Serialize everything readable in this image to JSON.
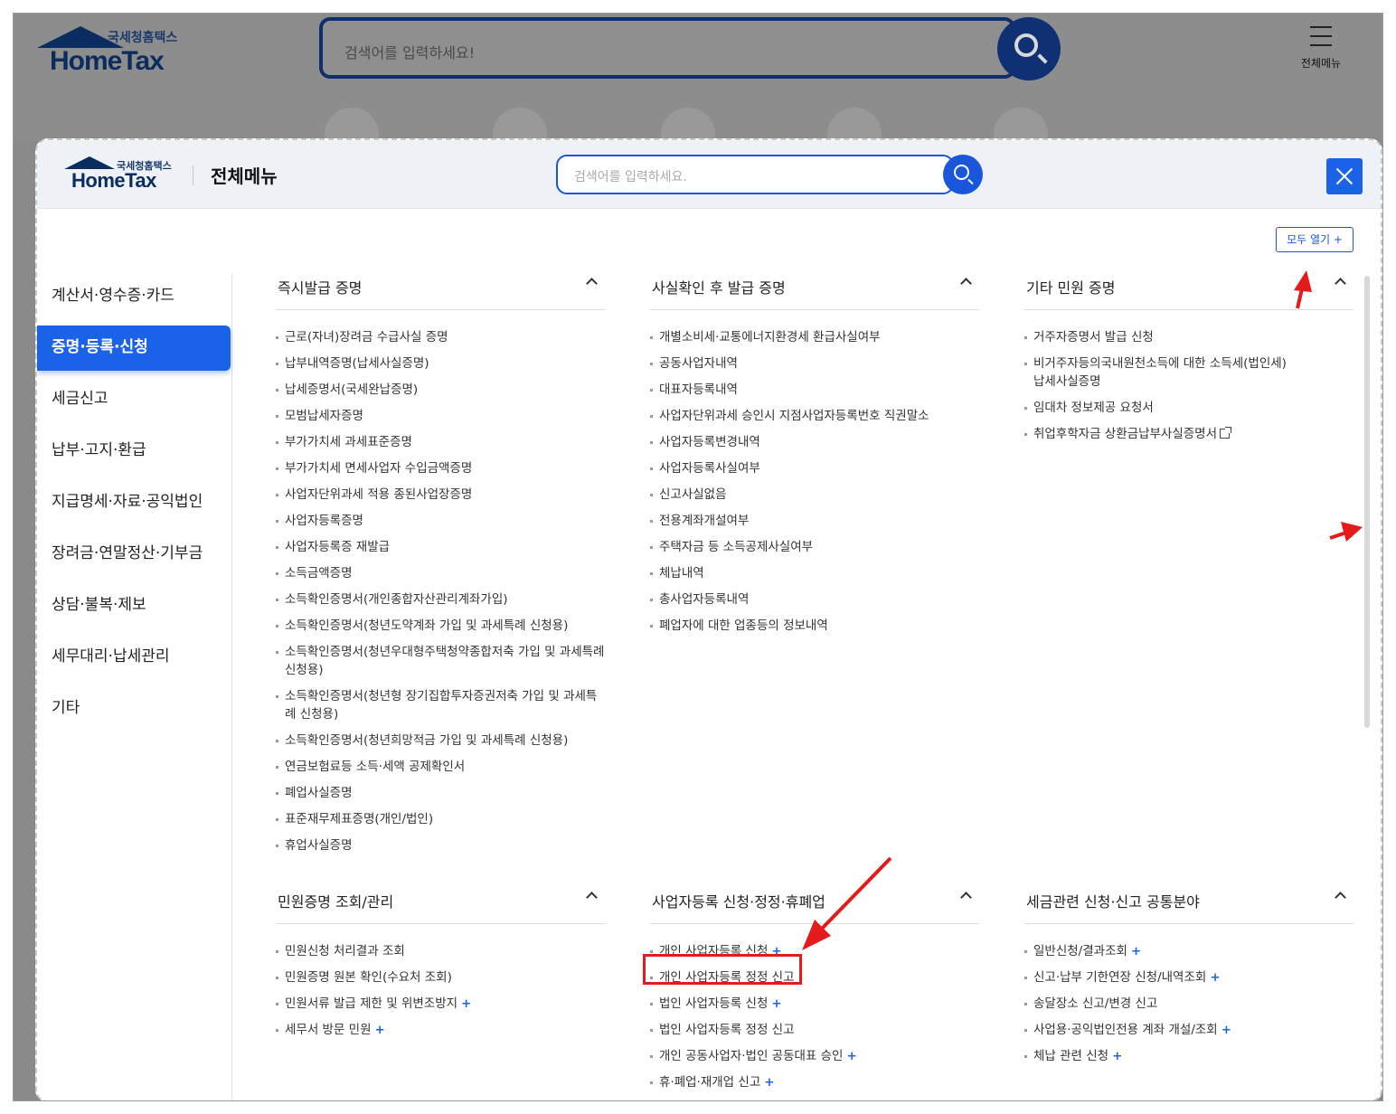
{
  "background": {
    "logo": {
      "kr": "국세청홈택스",
      "en": "HomeTax"
    },
    "search_placeholder": "검색어를 입력하세요!",
    "menu_label": "전체메뉴"
  },
  "modal": {
    "logo": {
      "kr": "국세청홈택스",
      "en": "HomeTax"
    },
    "title": "전체메뉴",
    "search_placeholder": "검색어를 입력하세요.",
    "open_all": "모두 열기 +",
    "accent_color": "#1a63e8",
    "annotation_color": "#e51a1a"
  },
  "sidebar": {
    "items": [
      {
        "label": "계산서·영수증·카드",
        "active": false
      },
      {
        "label": "증명·등록·신청",
        "active": true
      },
      {
        "label": "세금신고",
        "active": false
      },
      {
        "label": "납부·고지·환급",
        "active": false
      },
      {
        "label": "지급명세·자료·공익법인",
        "active": false
      },
      {
        "label": "장려금·연말정산·기부금",
        "active": false
      },
      {
        "label": "상담·불복·제보",
        "active": false
      },
      {
        "label": "세무대리·납세관리",
        "active": false
      },
      {
        "label": "기타",
        "active": false
      }
    ]
  },
  "sections": {
    "s1": {
      "title": "즉시발급 증명",
      "items": [
        "근로(자녀)장려금 수급사실 증명",
        "납부내역증명(납세사실증명)",
        "납세증명서(국세완납증명)",
        "모범납세자증명",
        "부가가치세 과세표준증명",
        "부가가치세 면세사업자 수입금액증명",
        "사업자단위과세 적용 종된사업장증명",
        "사업자등록증명",
        "사업자등록증 재발급",
        "소득금액증명",
        "소득확인증명서(개인종합자산관리계좌가입)",
        "소득확인증명서(청년도약계좌 가입 및 과세특례 신청용)",
        "소득확인증명서(청년우대형주택청약종합저축 가입 및 과세특례 신청용)",
        "소득확인증명서(청년형 장기집합투자증권저축 가입 및 과세특례 신청용)",
        "소득확인증명서(청년희망적금 가입 및 과세특례 신청용)",
        "연금보험료등 소득·세액 공제확인서",
        "폐업사실증명",
        "표준재무제표증명(개인/법인)",
        "휴업사실증명"
      ]
    },
    "s2": {
      "title": "사실확인 후 발급 증명",
      "items": [
        "개별소비세·교통에너지환경세 환급사실여부",
        "공동사업자내역",
        "대표자등록내역",
        "사업자단위과세 승인시 지점사업자등록번호 직권말소",
        "사업자등록변경내역",
        "사업자등록사실여부",
        "신고사실없음",
        "전용계좌개설여부",
        "주택자금 등 소득공제사실여부",
        "체납내역",
        "총사업자등록내역",
        "폐업자에 대한 업종등의 정보내역"
      ]
    },
    "s3": {
      "title": "기타 민원 증명",
      "items": [
        "거주자증명서 발급 신청",
        "비거주자등의국내원천소득에 대한 소득세(법인세) 납세사실증명",
        "임대차 정보제공 요청서",
        "취업후학자금 상환금납부사실증명서"
      ]
    },
    "s4": {
      "title": "민원증명 조회/관리",
      "items": [
        "민원신청 처리결과 조회",
        "민원증명 원본 확인(수요처 조회)",
        "민원서류 발급 제한 및 위변조방지",
        "세무서 방문 민원"
      ]
    },
    "s5": {
      "title": "사업자등록 신청·정정·휴폐업",
      "items": [
        "개인 사업자등록 신청",
        "개인 사업자등록 정정 신고",
        "법인 사업자등록 신청",
        "법인 사업자등록 정정 신고",
        "개인 공동사업자·법인 공동대표 승인",
        "휴·폐업·재개업 신고"
      ]
    },
    "s6": {
      "title": "세금관련 신청·신고 공통분야",
      "items": [
        "일반신청/결과조회",
        "신고·납부 기한연장 신청/내역조회",
        "송달장소 신고/변경 신고",
        "사업용·공익법인전용 계좌 개설/조회",
        "체납 관련 신청"
      ]
    }
  },
  "plus_symbol": "+"
}
